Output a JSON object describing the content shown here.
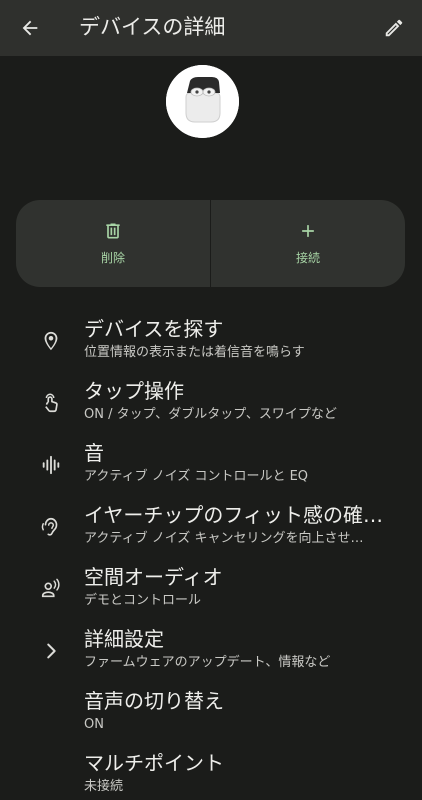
{
  "appbar": {
    "title": "デバイスの詳細",
    "back_icon": "arrow-back-icon",
    "edit_icon": "pencil-icon"
  },
  "device": {
    "image": "earbuds-case-image"
  },
  "actions": {
    "delete_label": "削除",
    "delete_icon": "trash-icon",
    "connect_label": "接続",
    "connect_icon": "plus-icon"
  },
  "settings": [
    {
      "icon": "location-pin-icon",
      "title": "デバイスを探す",
      "subtitle": "位置情報の表示または着信音を鳴らす"
    },
    {
      "icon": "touch-gesture-icon",
      "title": "タップ操作",
      "subtitle": "ON / タップ、ダブルタップ、スワイプなど"
    },
    {
      "icon": "sound-wave-icon",
      "title": "音",
      "subtitle": "アクティブ ノイズ コントロールと EQ"
    },
    {
      "icon": "ear-icon",
      "title": "イヤーチップのフィット感の確…",
      "subtitle": "アクティブ ノイズ キャンセリングを向上させ…"
    },
    {
      "icon": "spatial-audio-icon",
      "title": "空間オーディオ",
      "subtitle": "デモとコントロール"
    },
    {
      "icon": "chevron-right-icon",
      "title": "詳細設定",
      "subtitle": "ファームウェアのアップデート、情報など"
    },
    {
      "icon": "",
      "title": "音声の切り替え",
      "subtitle": "ON"
    },
    {
      "icon": "",
      "title": "マルチポイント",
      "subtitle": "未接続"
    }
  ],
  "colors": {
    "background": "#1b1c1a",
    "appbar": "#2f302d",
    "card": "#30322f",
    "accent": "#a8d5a6"
  }
}
